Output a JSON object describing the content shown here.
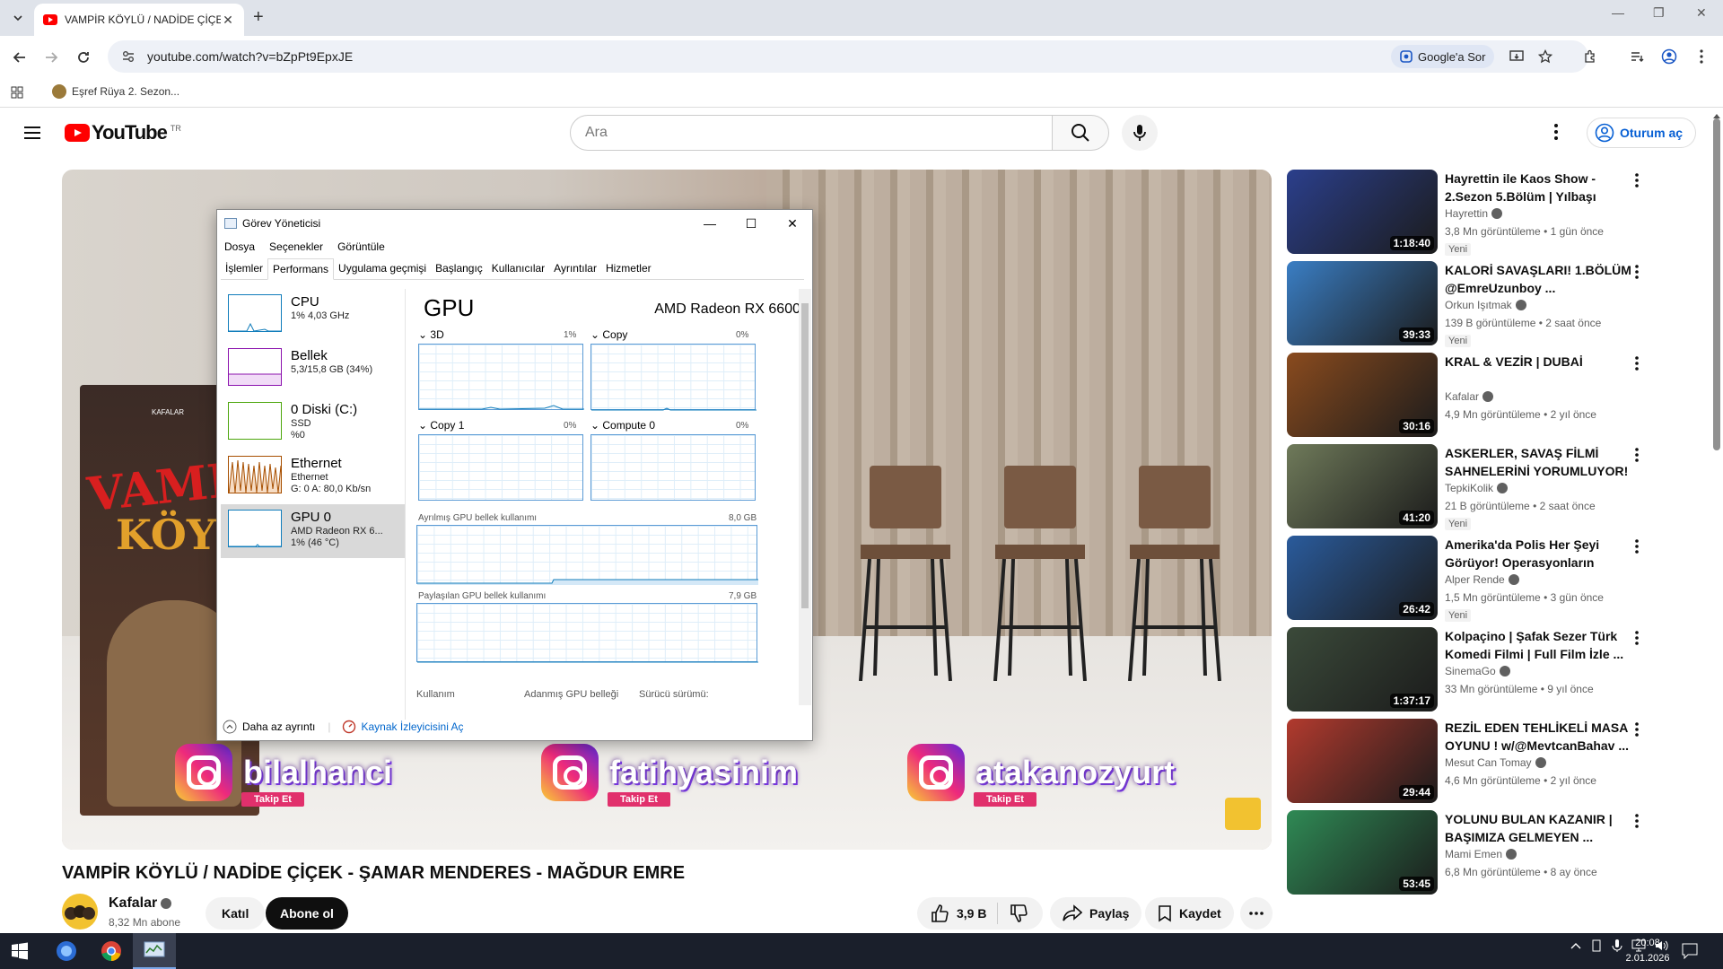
{
  "browser": {
    "tab_title": "VAMPİR KÖYLÜ / NADİDE ÇİÇEK",
    "url": "youtube.com/watch?v=bZpPt9EpxJE",
    "google_ask_label": "Google'a Sor",
    "bookmark_label": "Eşref Rüya 2. Sezon..."
  },
  "youtube": {
    "logo_text": "YouTube",
    "region": "TR",
    "search_placeholder": "Ara",
    "signin_label": "Oturum aç"
  },
  "overlay": {
    "handles": [
      "bilalhanci",
      "fatihyasinim",
      "atakanozyurt"
    ],
    "follow_label": "Takip Et",
    "banner_text_1": "VAMPİR",
    "banner_text_2": "KÖYL",
    "banner_logo": "KAFALAR"
  },
  "task_manager": {
    "title": "Görev Yöneticisi",
    "menu": [
      "Dosya",
      "Seçenekler",
      "Görüntüle"
    ],
    "tabs": [
      "İşlemler",
      "Performans",
      "Uygulama geçmişi",
      "Başlangıç",
      "Kullanıcılar",
      "Ayrıntılar",
      "Hizmetler"
    ],
    "active_tab": "Performans",
    "resources": [
      {
        "name": "CPU",
        "line1": "1% 4,03 GHz",
        "line2": "",
        "line3": "",
        "color": "#117dbb"
      },
      {
        "name": "Bellek",
        "line1": "5,3/15,8 GB (34%)",
        "line2": "",
        "line3": "",
        "color": "#8b12ae"
      },
      {
        "name": "0 Diski (C:)",
        "line1": "SSD",
        "line2": "%0",
        "line3": "",
        "color": "#4da60c"
      },
      {
        "name": "Ethernet",
        "line1": "Ethernet",
        "line2": "G: 0 A: 80,0 Kb/sn",
        "line3": "",
        "color": "#a74f01"
      },
      {
        "name": "GPU 0",
        "line1": "AMD Radeon RX 6...",
        "line2": "1% (46 °C)",
        "line3": "",
        "color": "#117dbb"
      }
    ],
    "gpu_heading": "GPU",
    "gpu_model": "AMD Radeon RX 6600",
    "engines": [
      {
        "name": "3D",
        "pct": "1%"
      },
      {
        "name": "Copy",
        "pct": "0%"
      },
      {
        "name": "Copy 1",
        "pct": "0%"
      },
      {
        "name": "Compute 0",
        "pct": "0%"
      }
    ],
    "dedicated_label": "Ayrılmış GPU bellek kullanımı",
    "dedicated_max": "8,0 GB",
    "shared_label": "Paylaşılan GPU bellek kullanımı",
    "shared_max": "7,9 GB",
    "bottom_labels": [
      "Kullanım",
      "Adanmış GPU belleği",
      "Sürücü sürümü:"
    ],
    "fewer_details": "Daha az ayrıntı",
    "resource_monitor": "Kaynak İzleyicisini Aç"
  },
  "video": {
    "title": "VAMPİR KÖYLÜ / NADİDE ÇİÇEK - ŞAMAR MENDERES - MAĞDUR EMRE",
    "channel": "Kafalar",
    "subscribers": "8,32 Mn abone",
    "join_label": "Katıl",
    "subscribe_label": "Abone ol",
    "likes": "3,9 B",
    "share_label": "Paylaş",
    "save_label": "Kaydet"
  },
  "recommendations": [
    {
      "title": "Hayrettin ile Kaos Show - 2.Sezon 5.Bölüm | Yılbaşı Özel...",
      "channel": "Hayrettin",
      "meta": "3,8 Mn görüntüleme • 1 gün önce",
      "badge": "Yeni",
      "duration": "1:18:40",
      "color": "#2b3f8c"
    },
    {
      "title": "KALORİ SAVAŞLARI! 1.BÖLÜM @EmreUzunboy ...",
      "channel": "Orkun Işıtmak",
      "meta": "139 B görüntüleme • 2 saat önce",
      "badge": "Yeni",
      "duration": "39:33",
      "color": "#3a7ec4"
    },
    {
      "title": "KRAL & VEZİR | DUBAİ",
      "channel": "Kafalar",
      "meta": "4,9 Mn görüntüleme • 2 yıl önce",
      "badge": "",
      "duration": "30:16",
      "color": "#8a4b1e"
    },
    {
      "title": "ASKERLER, SAVAŞ FİLMİ SAHNELERİNİ YORUMLUYOR!",
      "channel": "TepkiKolik",
      "meta": "21 B görüntüleme • 2 saat önce",
      "badge": "Yeni",
      "duration": "41:20",
      "color": "#6f7a5a"
    },
    {
      "title": "Amerika'da Polis Her Şeyi Görüyor! Operasyonların Perde...",
      "channel": "Alper Rende",
      "meta": "1,5 Mn görüntüleme • 3 gün önce",
      "badge": "Yeni",
      "duration": "26:42",
      "color": "#2a5b9c"
    },
    {
      "title": "Kolpaçino | Şafak Sezer Türk Komedi Filmi | Full Film İzle ...",
      "channel": "SinemaGo",
      "meta": "33 Mn görüntüleme • 9 yıl önce",
      "badge": "",
      "duration": "1:37:17",
      "color": "#3b4a3a"
    },
    {
      "title": "REZİL EDEN TEHLİKELİ MASA OYUNU ! w/@MevtcanBahav ...",
      "channel": "Mesut Can Tomay",
      "meta": "4,6 Mn görüntüleme • 2 yıl önce",
      "badge": "",
      "duration": "29:44",
      "color": "#b23a2e"
    },
    {
      "title": "YOLUNU BULAN KAZANIR | BAŞIMIZA GELMEYEN ...",
      "channel": "Mami Emen",
      "meta": "6,8 Mn görüntüleme • 8 ay önce",
      "badge": "",
      "duration": "53:45",
      "color": "#2f8a55"
    }
  ],
  "taskbar": {
    "time": "20:08",
    "date": "2.01.2026"
  }
}
